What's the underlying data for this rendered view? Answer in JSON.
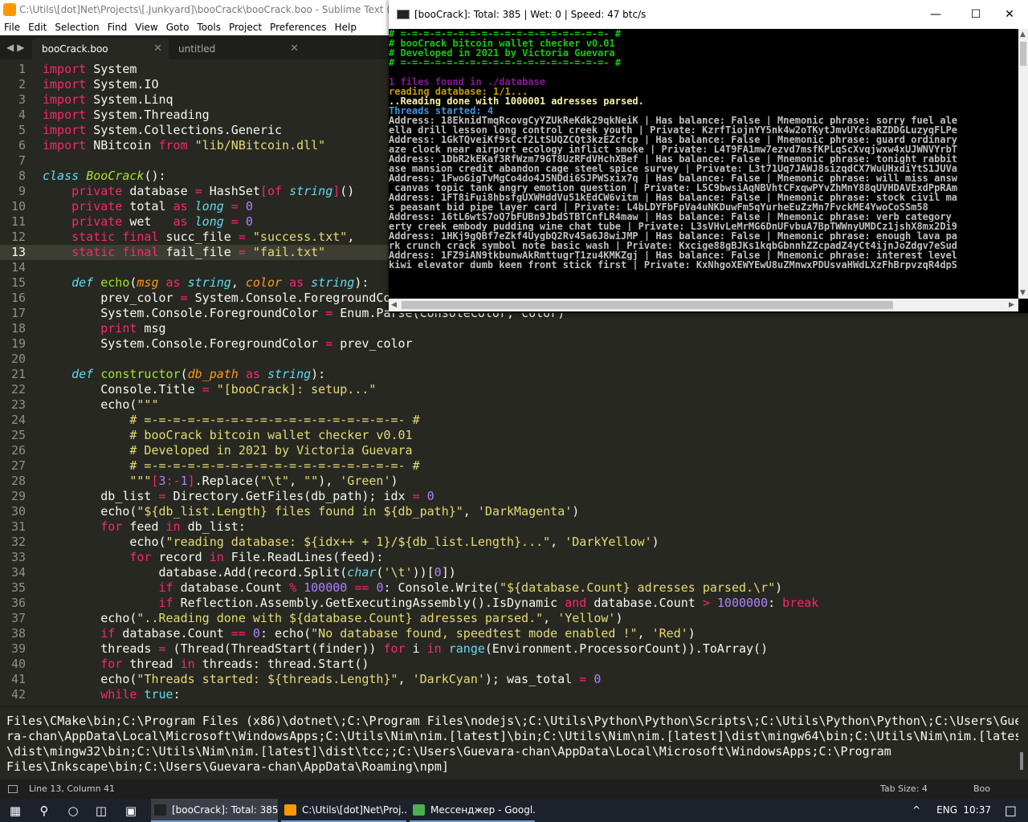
{
  "sublime": {
    "title": "C:\\Utils\\[dot]Net\\Projects\\[.Junkyard]\\booCrack\\booCrack.boo - Sublime Text (UNREG",
    "menu": [
      "File",
      "Edit",
      "Selection",
      "Find",
      "View",
      "Goto",
      "Tools",
      "Project",
      "Preferences",
      "Help"
    ],
    "tabs": [
      {
        "label": "booCrack.boo",
        "active": true
      },
      {
        "label": "untitled",
        "active": false
      }
    ],
    "current_line": 13,
    "code_lines": [
      "<span class=\"k\">import</span> System",
      "<span class=\"k\">import</span> System.IO",
      "<span class=\"k\">import</span> System.Linq",
      "<span class=\"k\">import</span> System.Threading",
      "<span class=\"k\">import</span> System.Collections.Generic",
      "<span class=\"k\">import</span> NBitcoin <span class=\"k\">from</span> <span class=\"s\">\"lib/NBitcoin.dll\"</span>",
      "",
      "<span class=\"t\">class</span> <span class=\"cls\">BooCrack</span>():",
      "    <span class=\"k\">private</span> database <span class=\"k\">=</span> HashSet<span class=\"k\">[of</span> <span class=\"t\">string</span><span class=\"k\">]</span>()",
      "    <span class=\"k\">private</span> total <span class=\"k\">as</span> <span class=\"t\">long</span> <span class=\"k\">=</span> <span class=\"n\">0</span>",
      "    <span class=\"k\">private</span> wet   <span class=\"k\">as</span> <span class=\"t\">long</span> <span class=\"k\">=</span> <span class=\"n\">0</span>",
      "    <span class=\"k\">static final</span> succ_file <span class=\"k\">=</span> <span class=\"s\">\"success.txt\"</span>,",
      "    <span class=\"k\">static final</span> fail_file <span class=\"k\">=</span> <span class=\"s\">\"fail.txt\"</span>",
      "",
      "    <span class=\"t\">def</span> <span class=\"f\">echo</span>(<span class=\"p\">msg</span> <span class=\"k\">as</span> <span class=\"t\">string</span>, <span class=\"p\">color</span> <span class=\"k\">as</span> <span class=\"t\">string</span>):",
      "        prev_color <span class=\"k\">=</span> System.Console.ForegroundColor",
      "        System.Console.ForegroundColor <span class=\"k\">=</span> Enum.Parse(ConsoleColor, color)",
      "        <span class=\"k\">print</span> msg",
      "        System.Console.ForegroundColor <span class=\"k\">=</span> prev_color",
      "",
      "    <span class=\"t\">def</span> <span class=\"f\">constructor</span>(<span class=\"p\">db_path</span> <span class=\"k\">as</span> <span class=\"t\">string</span>):",
      "        Console.Title <span class=\"k\">=</span> <span class=\"s\">\"[booCrack]: setup...\"</span>",
      "        echo(<span class=\"s\">\"\"\"</span>",
      "<span class=\"s\">            # =-=-=-=-=-=-=-=-=-=-=-=-=-=-=-=-=-=- #</span>",
      "<span class=\"s\">            # booCrack bitcoin wallet checker v0.01</span>",
      "<span class=\"s\">            # Developed in 2021 by Victoria Guevara</span>",
      "<span class=\"s\">            # =-=-=-=-=-=-=-=-=-=-=-=-=-=-=-=-=-=- #</span>",
      "<span class=\"s\">            \"\"\"</span><span class=\"k\">[</span><span class=\"n\">3</span><span class=\"k\">:-</span><span class=\"n\">1</span><span class=\"k\">]</span>.Replace(<span class=\"s\">\"\\t\"</span>, <span class=\"s\">\"\"</span>), <span class=\"s\">'Green'</span>)",
      "        db_list <span class=\"k\">=</span> Directory.GetFiles(db_path); idx <span class=\"k\">=</span> <span class=\"n\">0</span>",
      "        echo(<span class=\"s\">\"${db_list.Length} files found in ${db_path}\"</span>, <span class=\"s\">'DarkMagenta'</span>)",
      "        <span class=\"k\">for</span> feed <span class=\"k\">in</span> db_list:",
      "            echo(<span class=\"s\">\"reading database: ${idx++ + 1}/${db_list.Length}...\"</span>, <span class=\"s\">'DarkYellow'</span>)",
      "            <span class=\"k\">for</span> record <span class=\"k\">in</span> File.ReadLines(feed):",
      "                database.Add(record.Split(<span class=\"t\">char</span>(<span class=\"s\">'\\t'</span>))[<span class=\"n\">0</span>])",
      "                <span class=\"k\">if</span> database.Count <span class=\"k\">%</span> <span class=\"n\">100000</span> <span class=\"k\">==</span> <span class=\"n\">0</span>: Console.Write(<span class=\"s\">\"${database.Count} adresses parsed.\\r\"</span>)",
      "                <span class=\"k\">if</span> Reflection.Assembly.GetExecutingAssembly().IsDynamic <span class=\"k\">and</span> database.Count <span class=\"k\">&gt;</span> <span class=\"n\">1000000</span>: <span class=\"k\">break</span>",
      "        echo(<span class=\"s\">\"..Reading done with ${database.Count} adresses parsed.\"</span>, <span class=\"s\">'Yellow'</span>)",
      "        <span class=\"k\">if</span> database.Count <span class=\"k\">==</span> <span class=\"n\">0</span>: echo(<span class=\"s\">\"No database found, speedtest mode enabled !\"</span>, <span class=\"s\">'Red'</span>)",
      "        threads <span class=\"k\">=</span> (Thread(ThreadStart(finder)) <span class=\"k\">for</span> i <span class=\"k\">in</span> <span class=\"b\">range</span>(Environment.ProcessorCount)).ToArray()",
      "        <span class=\"k\">for</span> thread <span class=\"k\">in</span> threads: thread.Start()",
      "        echo(<span class=\"s\">\"Threads started: ${threads.Length}\"</span>, <span class=\"s\">'DarkCyan'</span>); was_total <span class=\"k\">=</span> <span class=\"n\">0</span>",
      "        <span class=\"k\">while</span> <span class=\"b\">true</span>:"
    ],
    "output_lines": [
      "Files\\CMake\\bin;C:\\Program Files (x86)\\dotnet\\;C:\\Program Files\\nodejs\\;C:\\Utils\\Python\\Python\\Scripts\\;C:\\Utils\\Python\\Python\\;C:\\Users\\Gueva",
      "ra-chan\\AppData\\Local\\Microsoft\\WindowsApps;C:\\Utils\\Nim\\nim.[latest]\\bin;C:\\Utils\\Nim\\nim.[latest]\\dist\\mingw64\\bin;C:\\Utils\\Nim\\nim.[latest]",
      "\\dist\\mingw32\\bin;C:\\Utils\\Nim\\nim.[latest]\\dist\\tcc;;C:\\Users\\Guevara-chan\\AppData\\Local\\Microsoft\\WindowsApps;C:\\Program",
      "Files\\Inkscape\\bin;C:\\Users\\Guevara-chan\\AppData\\Roaming\\npm]"
    ],
    "status": {
      "position": "Line 13, Column 41",
      "tab_size": "Tab Size: 4",
      "syntax": "Boo"
    }
  },
  "console": {
    "title": "[booCrack]: Total: 385 | Wet: 0 | Speed: 47 btc/s",
    "lines": [
      {
        "text": "# =-=-=-=-=-=-=-=-=-=-=-=-=-=-=-=-=-=- #",
        "color": "green"
      },
      {
        "text": "# booCrack bitcoin wallet checker v0.01",
        "color": "green"
      },
      {
        "text": "# Developed in 2021 by Victoria Guevara",
        "color": "green"
      },
      {
        "text": "# =-=-=-=-=-=-=-=-=-=-=-=-=-=-=-=-=-=- #",
        "color": "green"
      },
      {
        "text": "",
        "color": ""
      },
      {
        "text": "1 files found in ./database",
        "color": "magenta"
      },
      {
        "text": "reading database: 1/1...",
        "color": "yellowd"
      },
      {
        "text": "..Reading done with 1000001 adresses parsed.",
        "color": "yellow"
      },
      {
        "text": "Threads started: 4",
        "color": "cyan"
      },
      {
        "text": "Address: 18EknidTmqRcovgCyYZUkReKdk29qkNeiK | Has balance: False | Mnemonic phrase: sorry fuel ale",
        "color": ""
      },
      {
        "text": "ella drill lesson long control creek youth | Private: KzrfTiojnYY5nk4w2oTKytJmvUYc8aRZDDGLuzyqFLPe",
        "color": ""
      },
      {
        "text": "Address: 1GkTQveiKf9sCcf2LtSUQZCQt3kzEZcfcp | Has balance: False | Mnemonic phrase: guard ordinary",
        "color": ""
      },
      {
        "text": "aze clock near airport ecology inflict smoke | Private: L4T9FA1mw7ezvd7msfKPLqScXvqjwxw4xUJWNVYrbT",
        "color": ""
      },
      {
        "text": "Address: 1DbR2kEKaf3RfWzm79GT8UzRFdVHchXBef | Has balance: False | Mnemonic phrase: tonight rabbit",
        "color": ""
      },
      {
        "text": "ase mansion credit abandon cage steel spice survey | Private: L3t71Uq7JAWJ8sizqdCX7WuUHxdiYtS1JUVa",
        "color": ""
      },
      {
        "text": "Address: 1FwoGigTvMgCo4do4J5NDdi6SJPWSxix7q | Has balance: False | Mnemonic phrase: will miss answ",
        "color": ""
      },
      {
        "text": " canvas topic tank angry emotion question | Private: L5C9bwsiAqNBVhtCFxqwPYvZhMnY88qUVHDAVExdPpRAm",
        "color": ""
      },
      {
        "text": "Address: 1FT8iFui8hbsfgUXWHddVu51kEdCW6vitm | Has balance: False | Mnemonic phrase: stock civil ma",
        "color": ""
      },
      {
        "text": "s peasant bid pipe layer card | Private: L4bLDYFbFpVa4uNKDuwFm5qYurheEuZzMn7FvckME4YwoCoSSm58",
        "color": ""
      },
      {
        "text": "Address: 16tL6wtS7oQ7bFUBn9JbdSTBTCnfLR4maw | Has balance: False | Mnemonic phrase: verb category",
        "color": ""
      },
      {
        "text": "erty creek embody pudding wine chat tube | Private: L3sVHvLeMrMG6DnUFvbuA7BpTWWnyUMDCz1jshX8mx2Di9",
        "color": ""
      },
      {
        "text": "Address: 1HKj9gQBf7eZkf4UygbQ2Rv45a6J8wiJMP | Has balance: False | Mnemonic phrase: enough lava pa",
        "color": ""
      },
      {
        "text": "rk crunch crack symbol note basic wash | Private: Kxcige88gBJKs1kqbGbnnhZZcpadZ4yCt4ijnJoZdgv7eSud",
        "color": ""
      },
      {
        "text": "Address: 1FZ9iAN9tkbunwAkRmttugrT1zu4KMKZgj | Has balance: False | Mnemonic phrase: interest level",
        "color": ""
      },
      {
        "text": "kiwi elevator dumb keen front stick first | Private: KxNhgoXEWYEwU8uZMnwxPDUsvaHWdLXzFhBrpvzqR4dpS",
        "color": ""
      }
    ]
  },
  "taskbar": {
    "apps": [
      {
        "label": "[booCrack]: Total: 385...",
        "active": true,
        "color": "#222222"
      },
      {
        "label": "C:\\Utils\\[dot]Net\\Proj...",
        "active": false,
        "color": "#ff9800"
      },
      {
        "label": "Мессенджер - Googl...",
        "active": false,
        "color": "#4caf50"
      }
    ],
    "language": "ENG",
    "time": "10:37"
  }
}
